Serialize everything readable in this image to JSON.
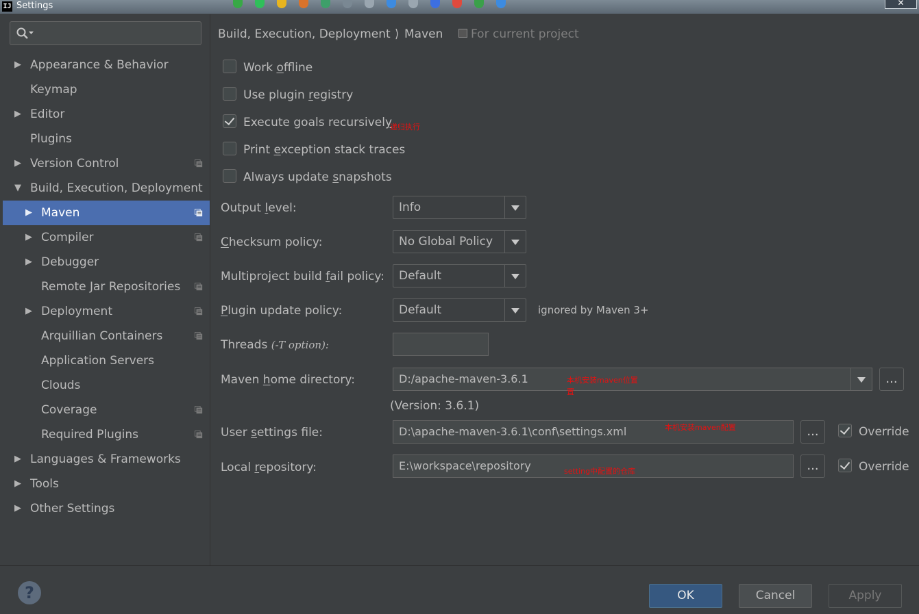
{
  "window": {
    "title": "Settings",
    "app_icon": "IJ"
  },
  "search": {
    "placeholder": ""
  },
  "tree": {
    "items": [
      {
        "label": "Appearance & Behavior",
        "expander": "collapsed",
        "level": 0,
        "project_icon": false
      },
      {
        "label": "Keymap",
        "expander": "none",
        "level": 0,
        "project_icon": false
      },
      {
        "label": "Editor",
        "expander": "collapsed",
        "level": 0,
        "project_icon": false
      },
      {
        "label": "Plugins",
        "expander": "none",
        "level": 0,
        "project_icon": false
      },
      {
        "label": "Version Control",
        "expander": "collapsed",
        "level": 0,
        "project_icon": true
      },
      {
        "label": "Build, Execution, Deployment",
        "expander": "expanded",
        "level": 0,
        "project_icon": false
      },
      {
        "label": "Maven",
        "expander": "collapsed",
        "level": 1,
        "project_icon": true,
        "selected": true
      },
      {
        "label": "Compiler",
        "expander": "collapsed",
        "level": 1,
        "project_icon": true
      },
      {
        "label": "Debugger",
        "expander": "collapsed",
        "level": 1,
        "project_icon": false
      },
      {
        "label": "Remote Jar Repositories",
        "expander": "none",
        "level": 1,
        "project_icon": true
      },
      {
        "label": "Deployment",
        "expander": "collapsed",
        "level": 1,
        "project_icon": true
      },
      {
        "label": "Arquillian Containers",
        "expander": "none",
        "level": 1,
        "project_icon": true
      },
      {
        "label": "Application Servers",
        "expander": "none",
        "level": 1,
        "project_icon": false
      },
      {
        "label": "Clouds",
        "expander": "none",
        "level": 1,
        "project_icon": false
      },
      {
        "label": "Coverage",
        "expander": "none",
        "level": 1,
        "project_icon": true
      },
      {
        "label": "Required Plugins",
        "expander": "none",
        "level": 1,
        "project_icon": true
      },
      {
        "label": "Languages & Frameworks",
        "expander": "collapsed",
        "level": 0,
        "project_icon": false
      },
      {
        "label": "Tools",
        "expander": "collapsed",
        "level": 0,
        "project_icon": false
      },
      {
        "label": "Other Settings",
        "expander": "collapsed",
        "level": 0,
        "project_icon": false
      }
    ]
  },
  "breadcrumb": {
    "parent": "Build, Execution, Deployment",
    "separator": "⟩",
    "current": "Maven",
    "note": "For current project"
  },
  "checkboxes": [
    {
      "pre": "Work ",
      "mn": "o",
      "post": "ffline",
      "checked": false
    },
    {
      "pre": "Use plugin ",
      "mn": "r",
      "post": "egistry",
      "checked": false
    },
    {
      "pre": "Execute goals recursivel",
      "mn": "y",
      "post": "",
      "checked": true
    },
    {
      "pre": "Print ",
      "mn": "e",
      "post": "xception stack traces",
      "checked": false
    },
    {
      "pre": "Always update ",
      "mn": "s",
      "post": "napshots",
      "checked": false
    }
  ],
  "fields": {
    "output_level": {
      "pre": "Output ",
      "mn": "l",
      "post": "evel:",
      "value": "Info"
    },
    "checksum_policy": {
      "pre": "",
      "mn": "C",
      "post": "hecksum policy:",
      "value": "No Global Policy"
    },
    "multiproject_policy": {
      "pre": "Multiproject build ",
      "mn": "f",
      "post": "ail policy:",
      "value": "Default"
    },
    "plugin_update_policy": {
      "pre": "",
      "mn": "P",
      "post": "lugin update policy:",
      "value": "Default",
      "hint": "ignored by Maven 3+"
    },
    "threads": {
      "label": "Threads",
      "hint": "(-T option):",
      "value": ""
    },
    "maven_home": {
      "pre": "Maven ",
      "mn": "h",
      "post": "ome directory:",
      "value": "D:/apache-maven-3.6.1",
      "version": "(Version: 3.6.1)"
    },
    "user_settings": {
      "pre": "User ",
      "mn": "s",
      "post": "ettings file:",
      "value": "D:\\apache-maven-3.6.1\\conf\\settings.xml",
      "override_label": "Override",
      "override": true
    },
    "local_repo": {
      "pre": "Local ",
      "mn": "r",
      "post": "epository:",
      "value": "E:\\workspace\\repository",
      "override_label": "Override",
      "override": true
    }
  },
  "annotations": {
    "recursive": "递归执行",
    "maven_home_1": "本机安装maven位置",
    "maven_home_2": "置",
    "user_settings": "本机安装maven配置",
    "local_repo": "setting中配置的仓库"
  },
  "browse_label": "...",
  "buttons": {
    "help": "?",
    "ok": "OK",
    "cancel": "Cancel",
    "apply": "Apply"
  },
  "colors": {
    "background": "#3c3f41",
    "selection": "#4b6eaf",
    "ok_button": "#365880",
    "annotation": "#e81010"
  }
}
